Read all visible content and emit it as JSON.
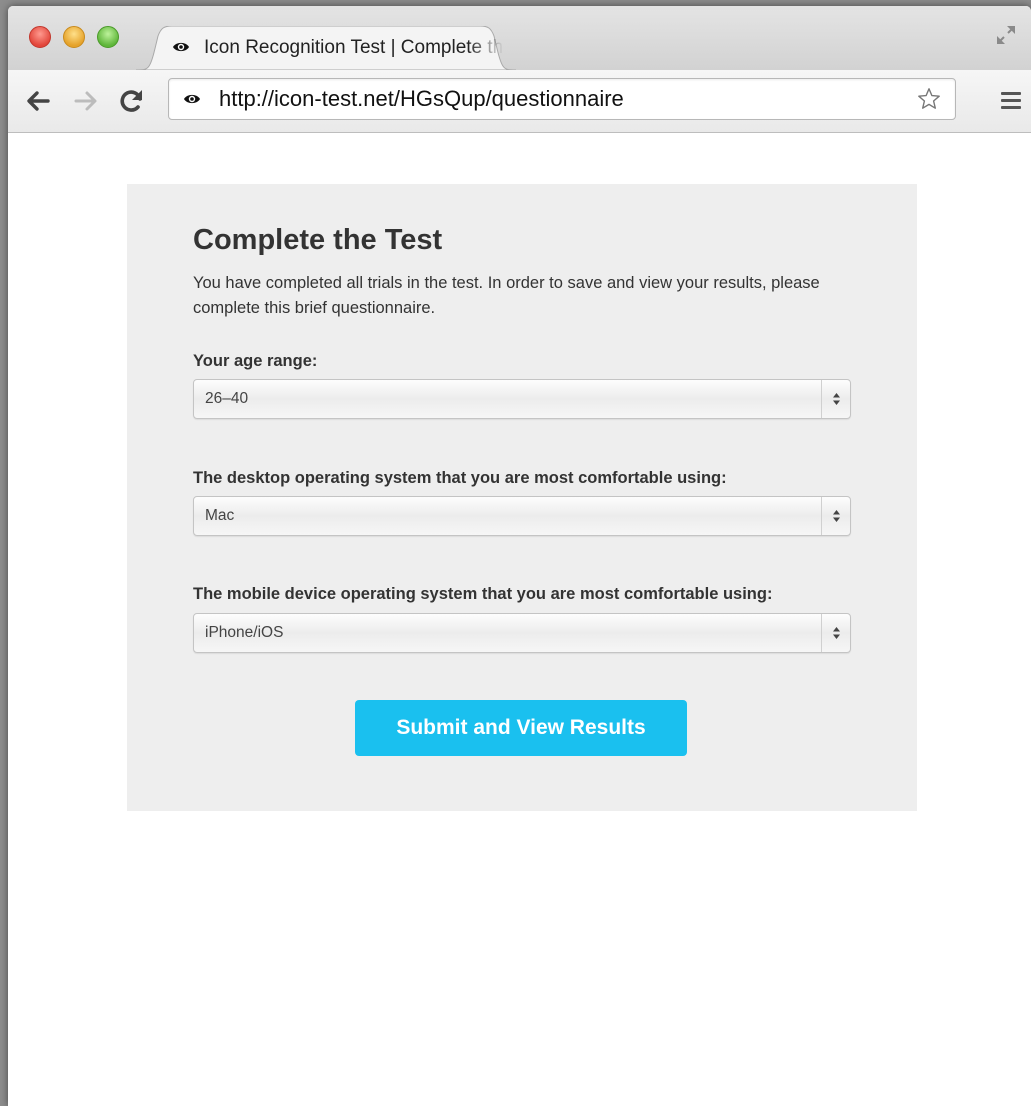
{
  "browser": {
    "tab_title": "Icon Recognition Test | Complete the Test",
    "url": "http://icon-test.net/HGsQup/questionnaire"
  },
  "page": {
    "heading": "Complete the Test",
    "intro": "You have completed all trials in the test. In order to save and view your results, please complete this brief questionnaire.",
    "age": {
      "label": "Your age range:",
      "value": "26–40"
    },
    "desktop_os": {
      "label": "The desktop operating system that you are most comfortable using:",
      "value": "Mac"
    },
    "mobile_os": {
      "label": "The mobile device operating system that you are most comfortable using:",
      "value": "iPhone/iOS"
    },
    "submit_label": "Submit and View Results"
  },
  "colors": {
    "accent": "#1ac0ef",
    "panel": "#eeeeee",
    "text": "#333333"
  },
  "icons": [
    "eye-icon",
    "back-arrow-icon",
    "forward-arrow-icon",
    "reload-icon",
    "star-icon",
    "menu-icon",
    "fullscreen-icon",
    "select-arrows-icon"
  ]
}
